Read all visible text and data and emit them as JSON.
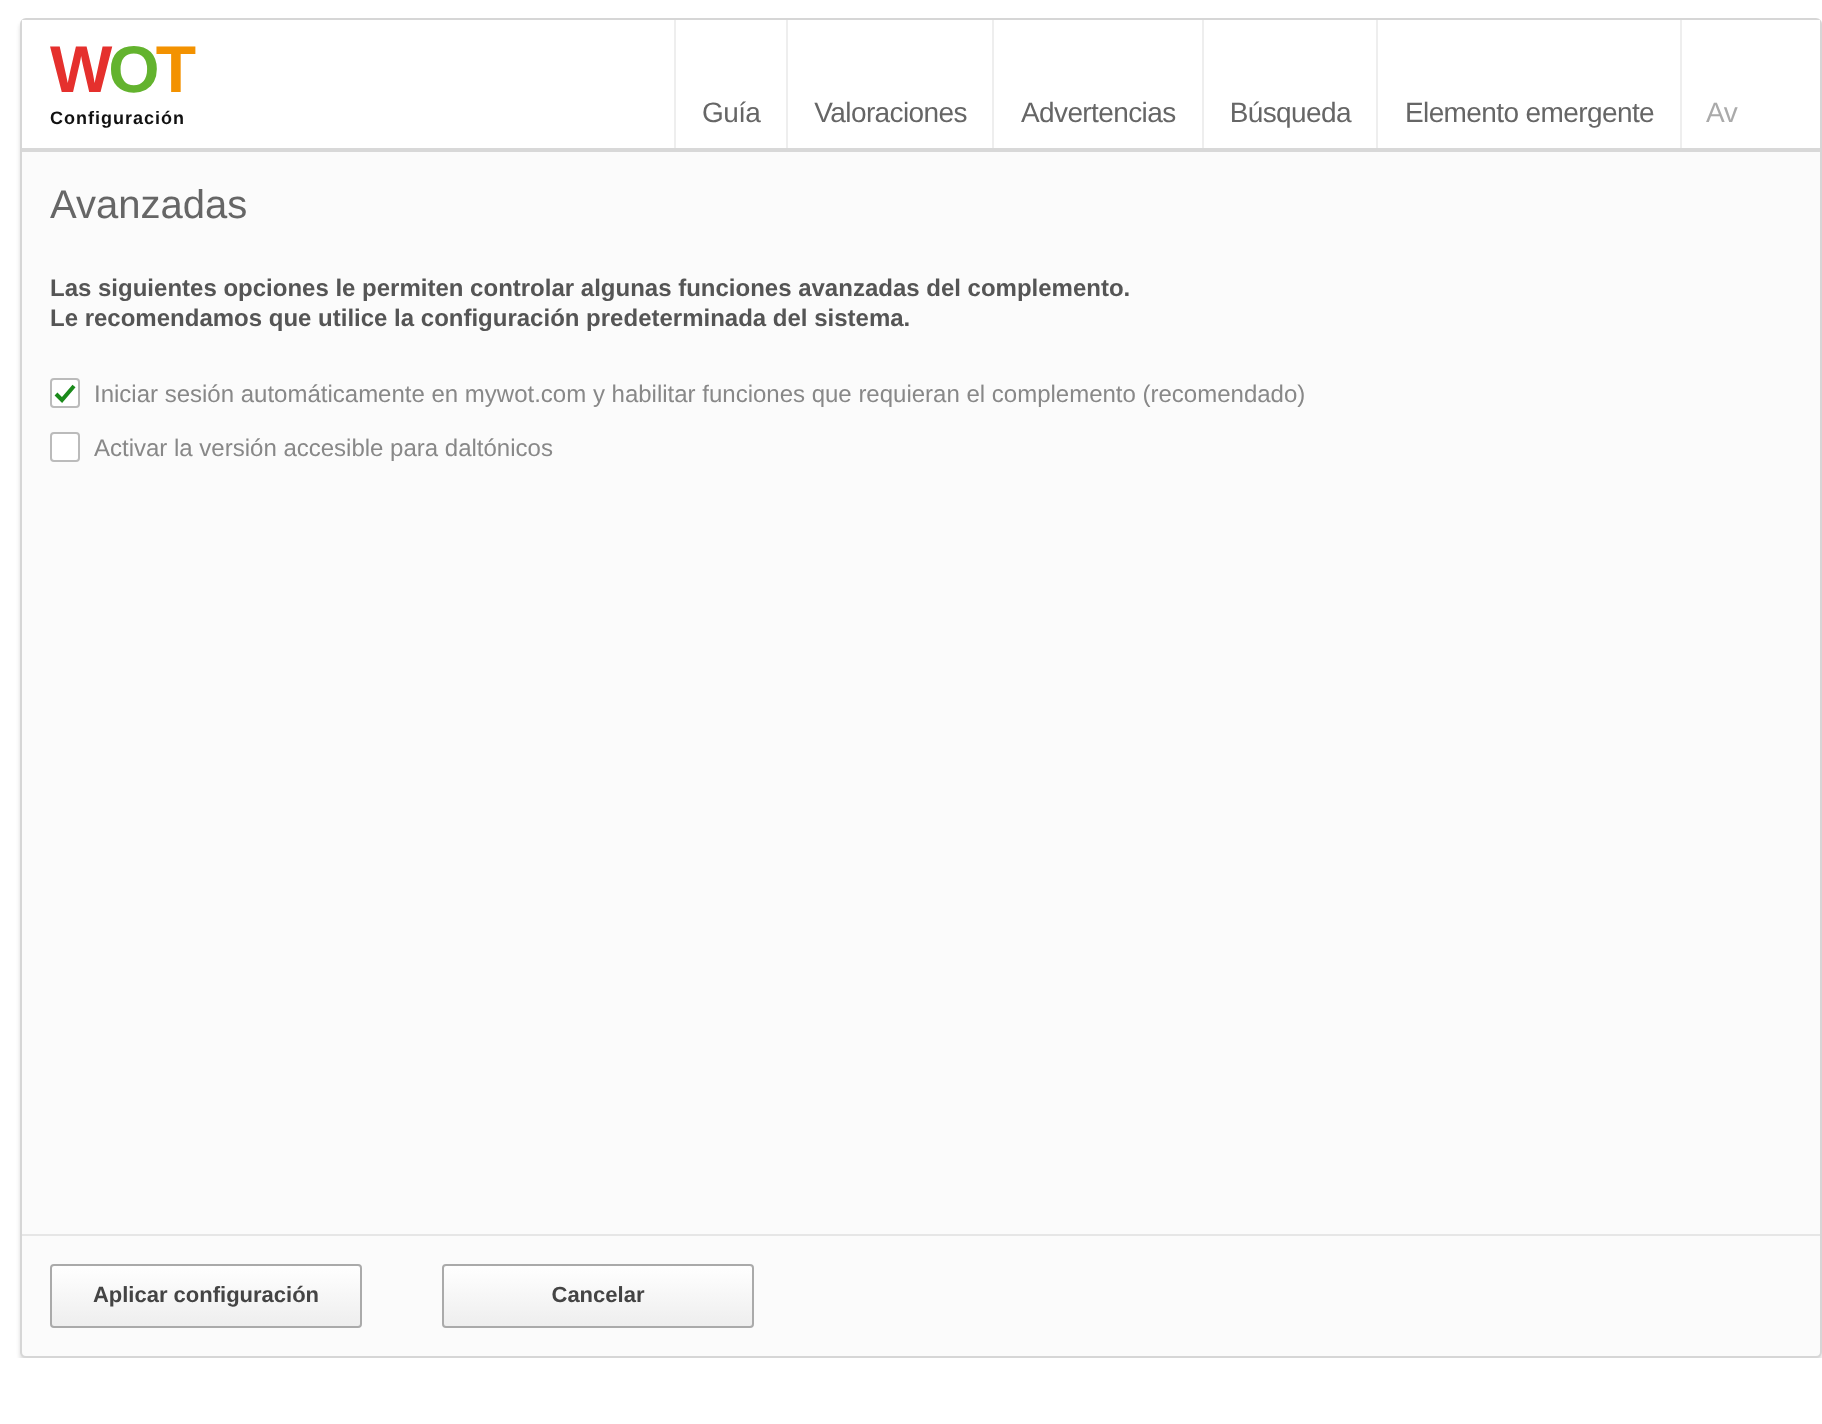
{
  "logo": {
    "text": "WOT",
    "subtitle": "Configuración"
  },
  "tabs": [
    {
      "label": "Guía",
      "selected": false
    },
    {
      "label": "Valoraciones",
      "selected": false
    },
    {
      "label": "Advertencias",
      "selected": false
    },
    {
      "label": "Búsqueda",
      "selected": false
    },
    {
      "label": "Elemento emergente",
      "selected": false
    },
    {
      "label": "Av",
      "selected": true
    }
  ],
  "section": {
    "title": "Avanzadas",
    "intro": [
      "Las siguientes opciones le permiten controlar algunas funciones avanzadas del complemento.",
      "Le recomendamos que utilice la configuración predeterminada del sistema."
    ]
  },
  "options": [
    {
      "label": "Iniciar sesión automáticamente en mywot.com y habilitar funciones que requieran el complemento (recomendado)",
      "checked": true
    },
    {
      "label": "Activar la versión accesible para daltónicos",
      "checked": false
    }
  ],
  "buttons": [
    "Aplicar configuración",
    "Cancelar"
  ]
}
